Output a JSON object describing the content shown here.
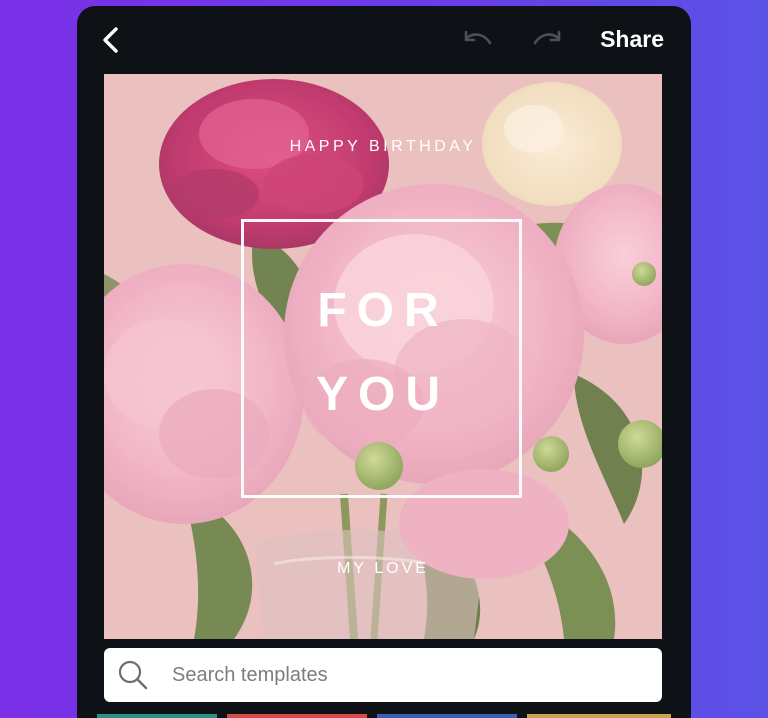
{
  "header": {
    "back_icon": "chevron-left-icon",
    "undo_icon": "undo-icon",
    "redo_icon": "redo-icon",
    "share_label": "Share"
  },
  "design": {
    "line1": "HAPPY BIRTHDAY",
    "line2": "FOR",
    "line3": "YOU",
    "line4": "MY LOVE",
    "background_image": "pink peony bouquet in glass vase"
  },
  "search": {
    "placeholder": "Search templates",
    "icon": "search-icon"
  },
  "colors": {
    "background_left": "#7a2fe6",
    "background_right": "#5b52e6",
    "app_bar": "#0e1116",
    "canvas_tint": "#e9c1bd",
    "text_on_design": "#ffffff"
  }
}
